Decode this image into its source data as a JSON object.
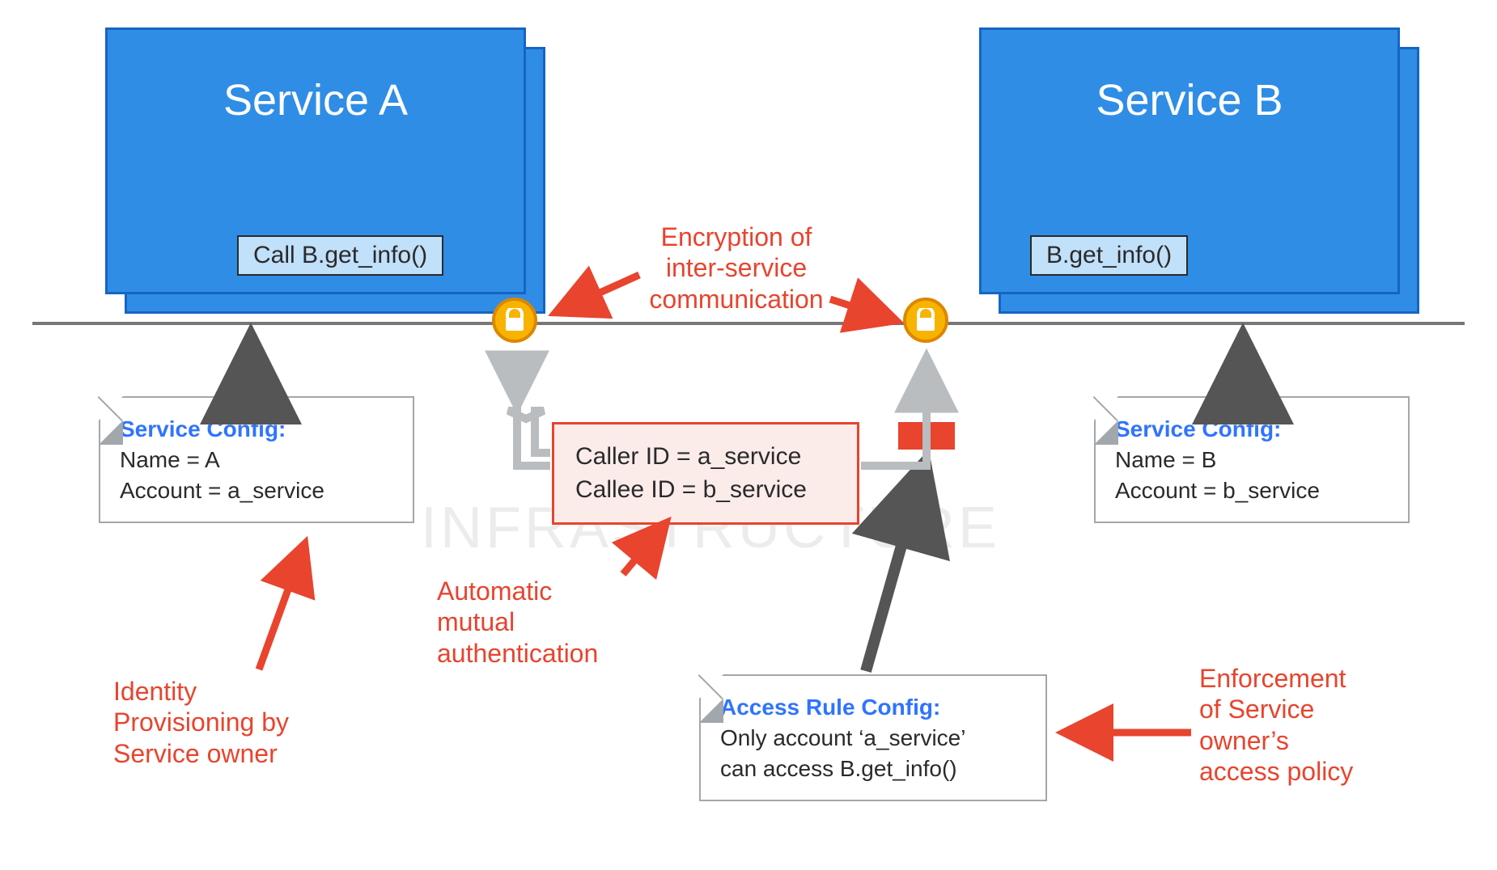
{
  "watermark": "INFRASTRUCTURE",
  "serviceA": {
    "title": "Service A",
    "chip": "Call B.get_info()",
    "config": {
      "header": "Service Config:",
      "line1": "Name = A",
      "line2": "Account  = a_service"
    }
  },
  "serviceB": {
    "title": "Service B",
    "chip": "B.get_info()",
    "config": {
      "header": "Service Config:",
      "line1": "Name = B",
      "line2": "Account  = b_service"
    }
  },
  "idbox": {
    "line1": "Caller  ID = a_service",
    "line2": "Callee ID =  b_service"
  },
  "accessRule": {
    "header": "Access Rule Config:",
    "line1": "Only account ‘a_service’",
    "line2": "can access B.get_info()"
  },
  "annotations": {
    "encryption_l1": "Encryption of",
    "encryption_l2": "inter-service",
    "encryption_l3": "communication",
    "auth_l1": "Automatic",
    "auth_l2": "mutual",
    "auth_l3": "authentication",
    "identity_l1": "Identity",
    "identity_l2": "Provisioning by",
    "identity_l3": "Service owner",
    "enforce_l1": "Enforcement",
    "enforce_l2": "of Service",
    "enforce_l3": "owner’s",
    "enforce_l4": "access policy"
  },
  "colors": {
    "red": "#e8442e",
    "blue": "#2f8de6",
    "lock": "#f8b301",
    "dark": "#555555"
  }
}
